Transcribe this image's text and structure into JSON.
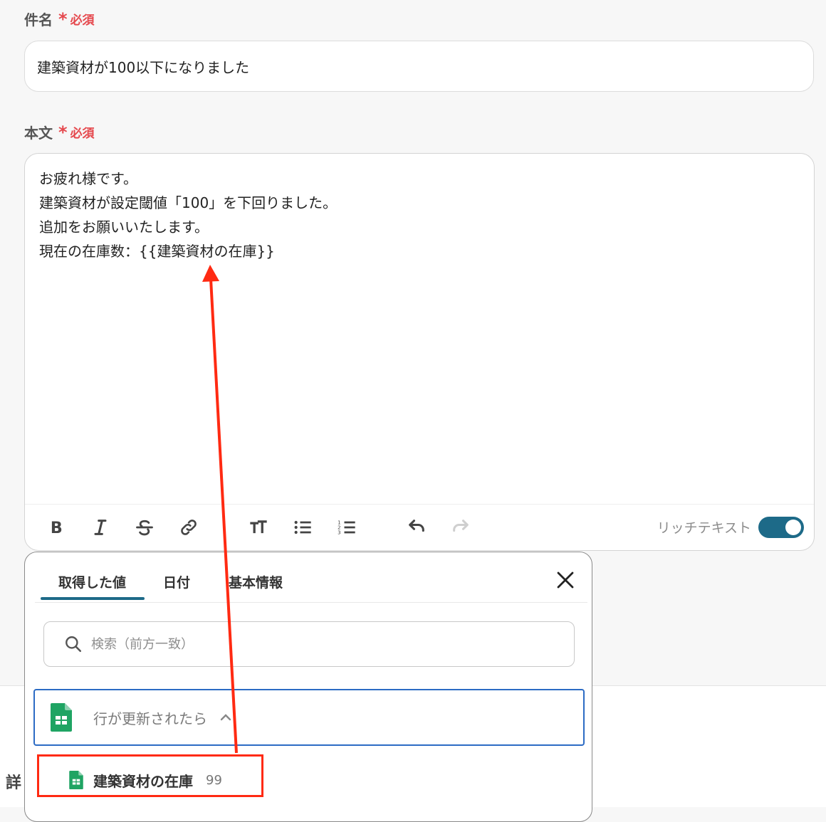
{
  "subject": {
    "label": "件名",
    "asterisk": "*",
    "required": "必須",
    "value": "建築資材が100以下になりました"
  },
  "body": {
    "label": "本文",
    "asterisk": "*",
    "required": "必須",
    "lines": [
      "お疲れ様です。",
      "建築資材が設定閾値「100」を下回りました。",
      "追加をお願いいたします。",
      "現在の在庫数：{{建築資材の在庫}}"
    ]
  },
  "toolbar": {
    "buttons": [
      "bold-icon",
      "italic-icon",
      "strikethrough-icon",
      "link-icon",
      "text-size-icon",
      "bullet-list-icon",
      "numbered-list-icon",
      "undo-icon",
      "redo-icon"
    ],
    "rich_text_label": "リッチテキスト",
    "rich_text_enabled": true
  },
  "popup": {
    "tabs": [
      "取得した値",
      "日付",
      "基本情報"
    ],
    "active_tab": "取得した値",
    "search_placeholder": "検索（前方一致）",
    "group": {
      "icon": "google-sheets-icon",
      "label": "行が更新されたら",
      "expanded": true
    },
    "items": [
      {
        "icon": "google-sheets-icon",
        "name": "建築資材の在庫",
        "value": "99"
      }
    ]
  },
  "side": {
    "partial_label": "詳"
  },
  "colors": {
    "accent": "#1d6a88",
    "required": "#e5484d",
    "annotation": "#ff2a12",
    "sheets_green": "#1fa463",
    "focus_border": "#2c6bc4"
  }
}
